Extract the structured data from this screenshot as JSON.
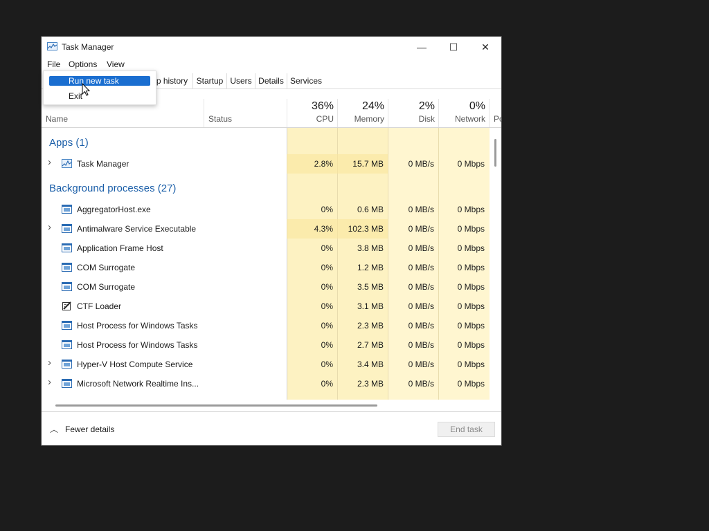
{
  "window": {
    "title": "Task Manager",
    "controls": {
      "minimize": "—",
      "maximize": "☐",
      "close": "✕"
    }
  },
  "menubar": {
    "file": "File",
    "options": "Options",
    "view": "View"
  },
  "file_menu": {
    "run_new_task": "Run new task",
    "exit": "Exit"
  },
  "tabs": [
    "p history",
    "Startup",
    "Users",
    "Details",
    "Services"
  ],
  "columns": {
    "name": "Name",
    "status": "Status",
    "cpu": {
      "pct": "36%",
      "label": "CPU"
    },
    "memory": {
      "pct": "24%",
      "label": "Memory"
    },
    "disk": {
      "pct": "2%",
      "label": "Disk"
    },
    "network": {
      "pct": "0%",
      "label": "Network"
    },
    "power": "Po"
  },
  "groups": {
    "apps": "Apps (1)",
    "background": "Background processes (27)"
  },
  "apps": [
    {
      "name": "Task Manager",
      "cpu": "2.8%",
      "memory": "15.7 MB",
      "disk": "0 MB/s",
      "network": "0 Mbps"
    }
  ],
  "background": [
    {
      "name": "AggregatorHost.exe",
      "cpu": "0%",
      "memory": "0.6 MB",
      "disk": "0 MB/s",
      "network": "0 Mbps"
    },
    {
      "name": "Antimalware Service Executable",
      "cpu": "4.3%",
      "memory": "102.3 MB",
      "disk": "0 MB/s",
      "network": "0 Mbps"
    },
    {
      "name": "Application Frame Host",
      "cpu": "0%",
      "memory": "3.8 MB",
      "disk": "0 MB/s",
      "network": "0 Mbps"
    },
    {
      "name": "COM Surrogate",
      "cpu": "0%",
      "memory": "1.2 MB",
      "disk": "0 MB/s",
      "network": "0 Mbps"
    },
    {
      "name": "COM Surrogate",
      "cpu": "0%",
      "memory": "3.5 MB",
      "disk": "0 MB/s",
      "network": "0 Mbps"
    },
    {
      "name": "CTF Loader",
      "cpu": "0%",
      "memory": "3.1 MB",
      "disk": "0 MB/s",
      "network": "0 Mbps"
    },
    {
      "name": "Host Process for Windows Tasks",
      "cpu": "0%",
      "memory": "2.3 MB",
      "disk": "0 MB/s",
      "network": "0 Mbps"
    },
    {
      "name": "Host Process for Windows Tasks",
      "cpu": "0%",
      "memory": "2.7 MB",
      "disk": "0 MB/s",
      "network": "0 Mbps"
    },
    {
      "name": "Hyper-V Host Compute Service",
      "cpu": "0%",
      "memory": "3.4 MB",
      "disk": "0 MB/s",
      "network": "0 Mbps"
    },
    {
      "name": "Microsoft Network Realtime Ins...",
      "cpu": "0%",
      "memory": "2.3 MB",
      "disk": "0 MB/s",
      "network": "0 Mbps"
    }
  ],
  "footer": {
    "fewer_details": "Fewer details",
    "end_task": "End task"
  },
  "colors": {
    "heat_light": "#fff8d6",
    "heat_mid": "#fdf0b8",
    "heat_strong": "#fae69c",
    "accent": "#1a6ed0",
    "group": "#1a5ea8"
  }
}
